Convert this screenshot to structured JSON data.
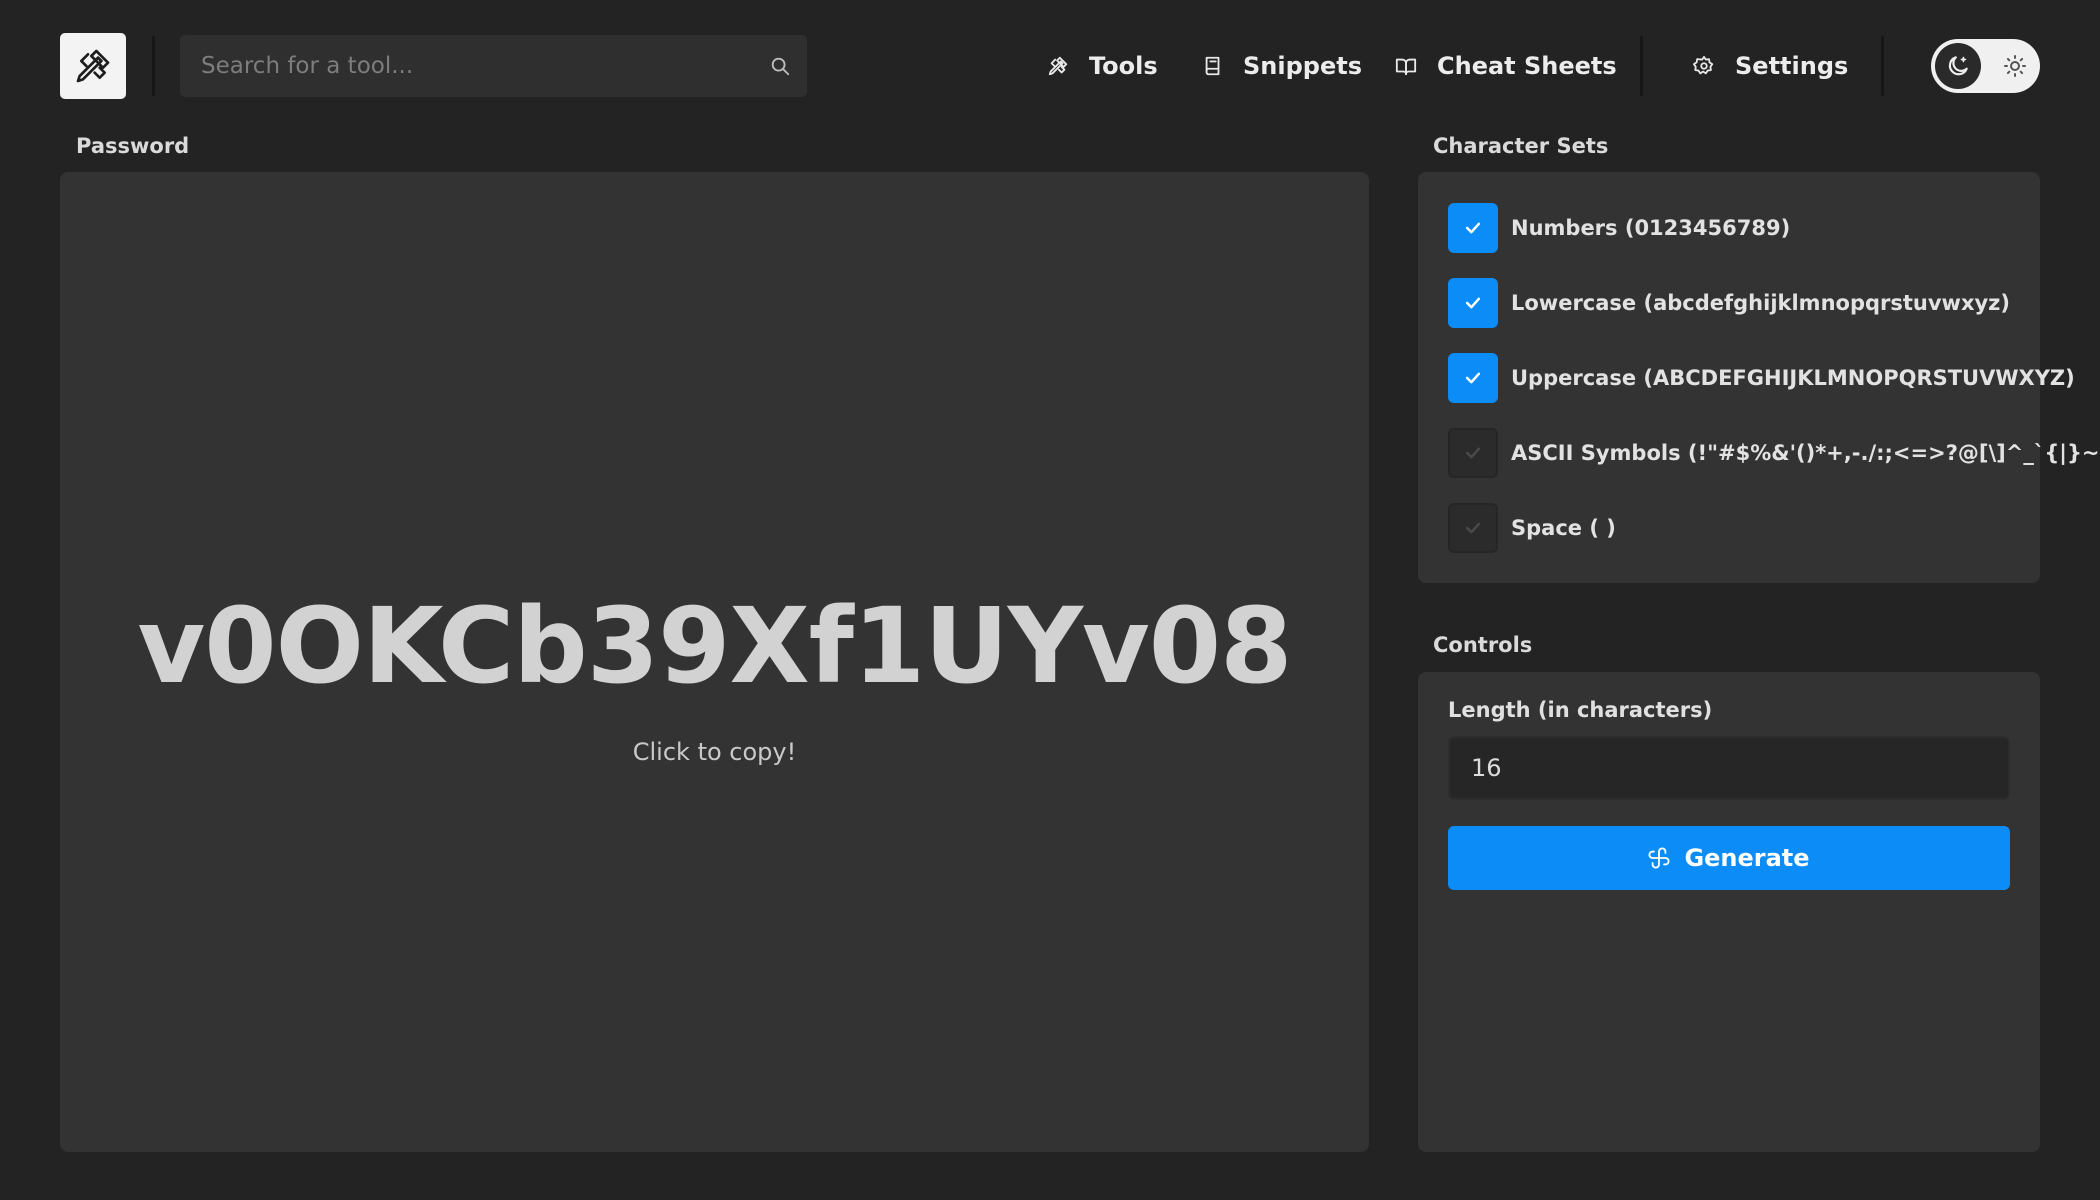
{
  "header": {
    "logo_icon": "tools-icon",
    "search": {
      "placeholder": "Search for a tool...",
      "value": ""
    },
    "nav": [
      {
        "label": "Tools",
        "icon": "tools-icon"
      },
      {
        "label": "Snippets",
        "icon": "book-icon"
      },
      {
        "label": "Cheat Sheets",
        "icon": "open-book-icon"
      },
      {
        "label": "Settings",
        "icon": "gear-icon"
      }
    ],
    "theme": {
      "mode": "dark",
      "dark_icon": "moon-icon",
      "light_icon": "sun-icon"
    }
  },
  "password_section": {
    "label": "Password",
    "password": "v0OKCb39Xf1UYv08",
    "hint": "Click to copy!"
  },
  "character_sets": {
    "label": "Character Sets",
    "items": [
      {
        "label": "Numbers (0123456789)",
        "checked": true
      },
      {
        "label": "Lowercase (abcdefghijklmnopqrstuvwxyz)",
        "checked": true
      },
      {
        "label": "Uppercase (ABCDEFGHIJKLMNOPQRSTUVWXYZ)",
        "checked": true
      },
      {
        "label": "ASCII Symbols (!\"#$%&'()*+,-./:;<=>?@[\\]^_`{|}~)",
        "checked": false
      },
      {
        "label": "Space ( )",
        "checked": false
      }
    ]
  },
  "controls": {
    "label": "Controls",
    "length_label": "Length (in characters)",
    "length_value": "16",
    "generate_label": "Generate"
  },
  "colors": {
    "background": "#232323",
    "panel": "#333333",
    "accent": "#0b8cf7"
  }
}
